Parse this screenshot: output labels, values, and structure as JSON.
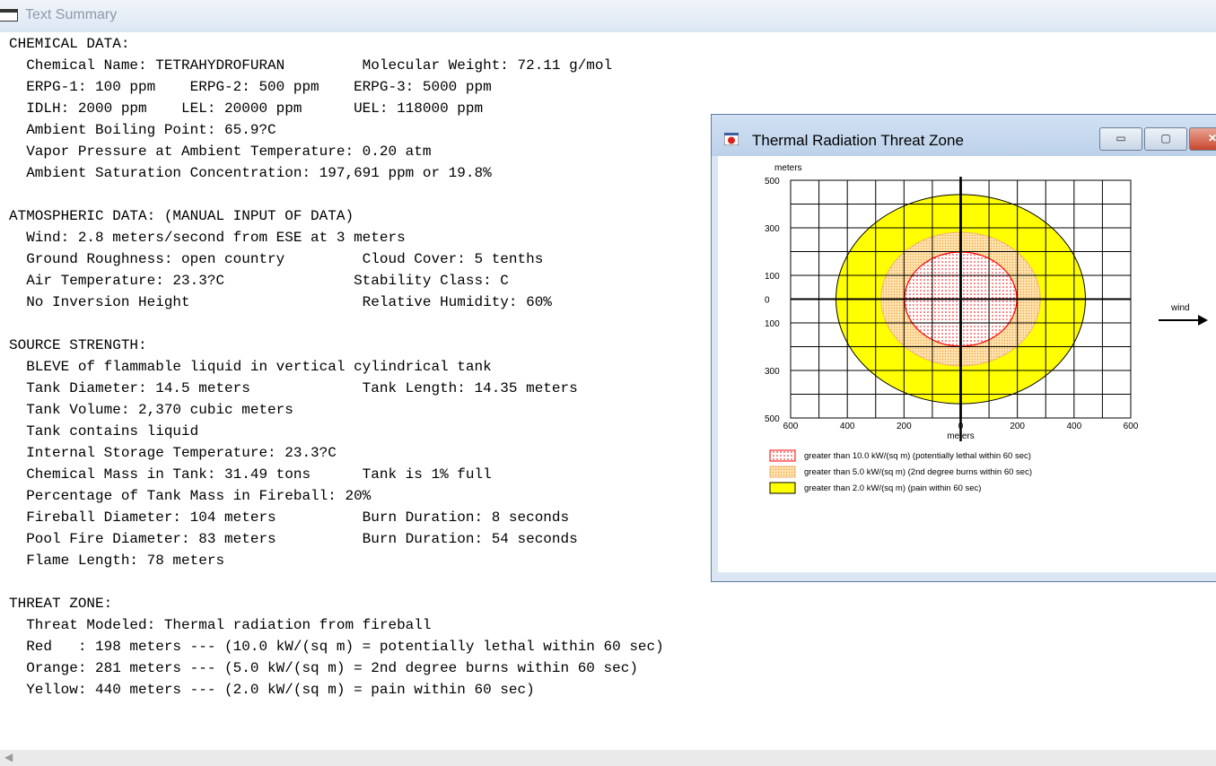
{
  "window": {
    "title": "Text Summary"
  },
  "summary_lines": [
    "CHEMICAL DATA:",
    "  Chemical Name: TETRAHYDROFURAN         Molecular Weight: 72.11 g/mol",
    "  ERPG-1: 100 ppm    ERPG-2: 500 ppm    ERPG-3: 5000 ppm",
    "  IDLH: 2000 ppm    LEL: 20000 ppm      UEL: 118000 ppm",
    "  Ambient Boiling Point: 65.9?C",
    "  Vapor Pressure at Ambient Temperature: 0.20 atm",
    "  Ambient Saturation Concentration: 197,691 ppm or 19.8%",
    "",
    "ATMOSPHERIC DATA: (MANUAL INPUT OF DATA)",
    "  Wind: 2.8 meters/second from ESE at 3 meters",
    "  Ground Roughness: open country         Cloud Cover: 5 tenths",
    "  Air Temperature: 23.3?C               Stability Class: C",
    "  No Inversion Height                    Relative Humidity: 60%",
    "",
    "SOURCE STRENGTH:",
    "  BLEVE of flammable liquid in vertical cylindrical tank",
    "  Tank Diameter: 14.5 meters             Tank Length: 14.35 meters",
    "  Tank Volume: 2,370 cubic meters",
    "  Tank contains liquid",
    "  Internal Storage Temperature: 23.3?C",
    "  Chemical Mass in Tank: 31.49 tons      Tank is 1% full",
    "  Percentage of Tank Mass in Fireball: 20%",
    "  Fireball Diameter: 104 meters          Burn Duration: 8 seconds",
    "  Pool Fire Diameter: 83 meters          Burn Duration: 54 seconds",
    "  Flame Length: 78 meters",
    "",
    "THREAT ZONE:",
    "  Threat Modeled: Thermal radiation from fireball",
    "  Red   : 198 meters --- (10.0 kW/(sq m) = potentially lethal within 60 sec)",
    "  Orange: 281 meters --- (5.0 kW/(sq m) = 2nd degree burns within 60 sec)",
    "  Yellow: 440 meters --- (2.0 kW/(sq m) = pain within 60 sec)"
  ],
  "popup": {
    "title": "Thermal Radiation Threat Zone",
    "buttons": {
      "minimize": "▭",
      "maximize": "▢",
      "close": "✕"
    }
  },
  "chart_data": {
    "type": "threat-zone-map",
    "xunit": "meters",
    "yunit": "meters",
    "xlabel": "meters",
    "ylabel": "meters",
    "xlim": [
      -600,
      600
    ],
    "ylim": [
      -500,
      500
    ],
    "xtick_labels": [
      {
        "value": -600,
        "label": "600"
      },
      {
        "value": -400,
        "label": "400"
      },
      {
        "value": -200,
        "label": "200"
      },
      {
        "value": 0,
        "label": "0"
      },
      {
        "value": 200,
        "label": "200"
      },
      {
        "value": 400,
        "label": "400"
      },
      {
        "value": 600,
        "label": "600"
      }
    ],
    "ytick_labels": [
      {
        "value": 500,
        "label": "500"
      },
      {
        "value": 300,
        "label": "300"
      },
      {
        "value": 100,
        "label": "100"
      },
      {
        "value": 0,
        "label": "0"
      },
      {
        "value": -100,
        "label": "100"
      },
      {
        "value": -300,
        "label": "300"
      },
      {
        "value": -500,
        "label": "500"
      }
    ],
    "grid_step": 100,
    "grid": true,
    "wind_label": "wind",
    "zones": [
      {
        "level": "yellow",
        "radius": 440,
        "color": "#ffff00",
        "legend": "greater than 2.0 kW/(sq m) (pain within 60 sec)"
      },
      {
        "level": "orange",
        "radius": 281,
        "color": "#ffd79a",
        "legend": "greater than 5.0 kW/(sq m) (2nd degree burns within 60 sec)"
      },
      {
        "level": "red",
        "radius": 198,
        "color": "#ff0000",
        "legend": "greater than 10.0 kW/(sq m) (potentially lethal within 60 sec)"
      }
    ],
    "legend_order": [
      "red",
      "orange",
      "yellow"
    ]
  }
}
